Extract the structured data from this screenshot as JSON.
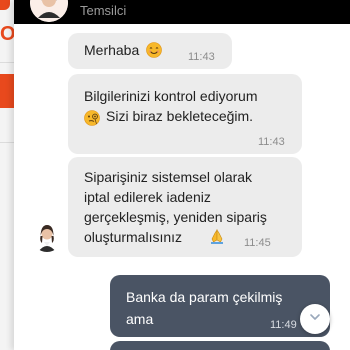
{
  "header": {
    "agent_role": "Temsilci"
  },
  "messages": [
    {
      "id": "m1",
      "direction": "incoming",
      "text": "Merhaba",
      "emoji": "smiling-face-icon",
      "time": "11:43"
    },
    {
      "id": "m2",
      "direction": "incoming",
      "line1": "Bilgilerinizi kontrol ediyorum",
      "line2": "Sizi biraz bekleteceğim.",
      "emoji": "face-with-monocle-icon",
      "time": "11:43"
    },
    {
      "id": "m3",
      "direction": "incoming",
      "lines": [
        "Siparişiniz sistemsel olarak",
        "iptal edilerek iadeniz",
        "gerçekleşmiş, yeniden sipariş",
        "oluşturmalısınız"
      ],
      "emoji": "folded-hands-icon",
      "time": "11:45"
    },
    {
      "id": "m4",
      "direction": "outgoing",
      "lines": [
        "Banka da param çekilmiş",
        "ama"
      ],
      "time": "11:49"
    }
  ],
  "colors": {
    "outgoing_bubble": "#4a5464",
    "incoming_bubble": "#ececec",
    "header": "#000000",
    "brand_orange": "#e8491d"
  }
}
